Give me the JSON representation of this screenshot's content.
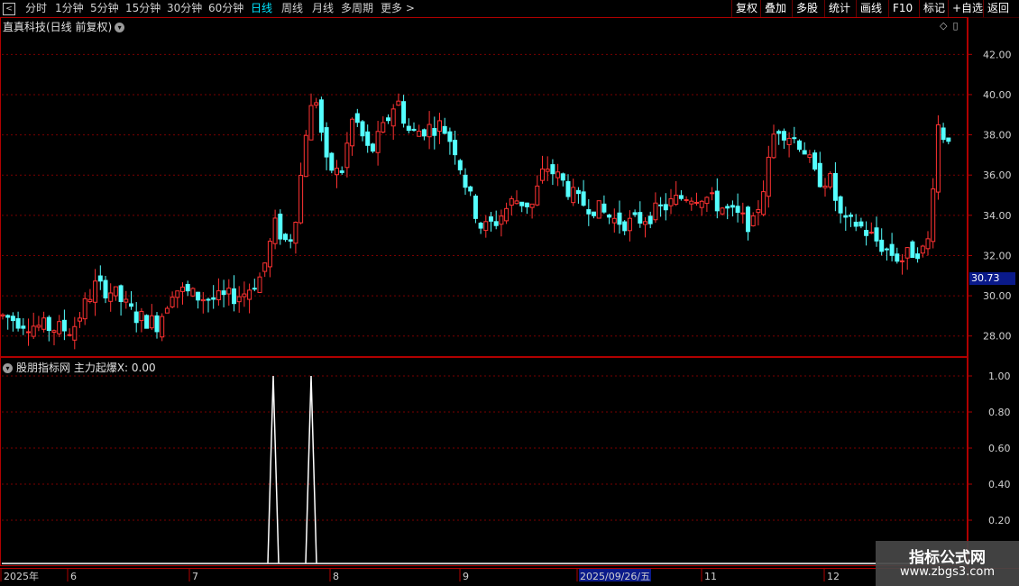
{
  "toolbar": {
    "periods": [
      "分时",
      "1分钟",
      "5分钟",
      "15分钟",
      "30分钟",
      "60分钟",
      "日线",
      "周线",
      "月线",
      "多周期",
      "更多 >"
    ],
    "selected_period": "日线",
    "actions": [
      "复权",
      "叠加",
      "多股",
      "统计",
      "画线",
      "F10",
      "标记",
      "+自选",
      "返回"
    ]
  },
  "stock": {
    "title": "直真科技(日线 前复权)",
    "current_price_tag": "30.73",
    "price_axis": [
      "42.00",
      "40.00",
      "38.00",
      "36.00",
      "34.00",
      "32.00",
      "30.00",
      "28.00"
    ]
  },
  "indicator": {
    "title": "股朋指标网 主力起爆X: 0.00",
    "axis": [
      "1.00",
      "0.80",
      "0.60",
      "0.40",
      "0.20"
    ],
    "signals": [
      {
        "date_index": 60,
        "value": 1.0
      },
      {
        "date_index": 224,
        "value": 1.0
      }
    ]
  },
  "time_axis": {
    "labels": [
      "2025年",
      "6",
      "7",
      "8",
      "9",
      "2025/09/26/五",
      "11",
      "12"
    ],
    "highlighted": "2025/09/26/五"
  },
  "watermark": {
    "name": "指标公式网",
    "url": "www.zbgs3.com"
  },
  "colors": {
    "up": "#ff3232",
    "down": "#54ffff",
    "grid": "#7a0000",
    "frame": "#b00000",
    "indicator_line": "#ffffff",
    "price_tag_bg": "#0a1a8a"
  },
  "chart_data": {
    "type": "candlestick",
    "y_range": [
      27,
      43
    ],
    "candles": []
  }
}
